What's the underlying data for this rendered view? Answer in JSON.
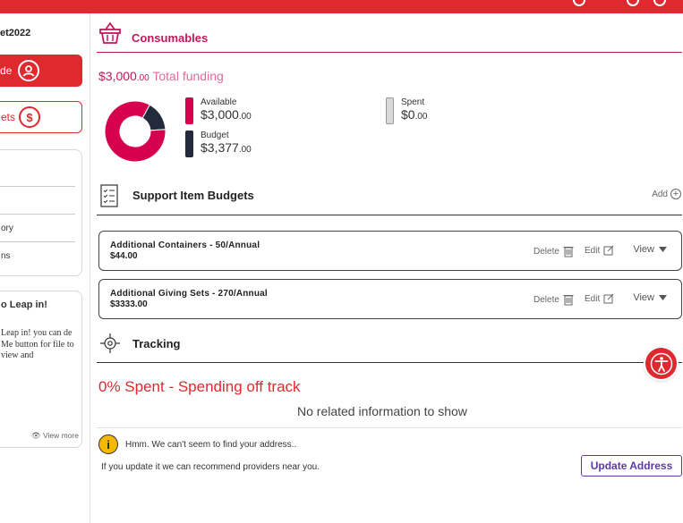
{
  "sidebar": {
    "plan_name": "et2022",
    "guide_button_label": "de",
    "budgets_button_label": "ets",
    "budgets_icon": "$",
    "menu_items": [
      "ory",
      "ns"
    ],
    "leap_card": {
      "title": "o Leap in!",
      "body": "Leap in! you can de Me button for file to view and",
      "view_more": "View more"
    }
  },
  "consumables": {
    "title": "Consumables",
    "funding_dollars": "$3,000",
    "funding_cents": ".00",
    "funding_label": "Total funding",
    "donut": {
      "available": 3000,
      "budget": 3377,
      "spent": 0
    },
    "available_label": "Available",
    "available_dollars": "$3,000",
    "available_cents": ".00",
    "budget_label": "Budget",
    "budget_dollars": "$3,377",
    "budget_cents": ".00",
    "spent_label": "Spent",
    "spent_dollars": "$0",
    "spent_cents": ".00"
  },
  "support_items": {
    "title": "Support Item Budgets",
    "add_label": "Add",
    "items": [
      {
        "name": "Additional Containers - 50/Annual",
        "amount": "$44.00",
        "delete_label": "Delete",
        "edit_label": "Edit",
        "view_label": "View"
      },
      {
        "name": "Additional Giving Sets - 270/Annual",
        "amount": "$3333.00",
        "delete_label": "Delete",
        "edit_label": "Edit",
        "view_label": "View"
      }
    ]
  },
  "tracking": {
    "title": "Tracking",
    "status_text": "0% Spent - Spending off track",
    "empty_text": "No related information to show"
  },
  "address": {
    "warning_icon": "i",
    "message": "Hmm. We can't seem to find your address..",
    "hint": "If you update it we can recommend providers near you.",
    "update_button": "Update Address"
  },
  "colors": {
    "brand_red": "#e0282f",
    "accent_magenta": "#c2185b",
    "available": "#d6004f",
    "budget": "#222a3b",
    "spent": "#d9d9d9",
    "update_purple": "#5b3aa8"
  }
}
